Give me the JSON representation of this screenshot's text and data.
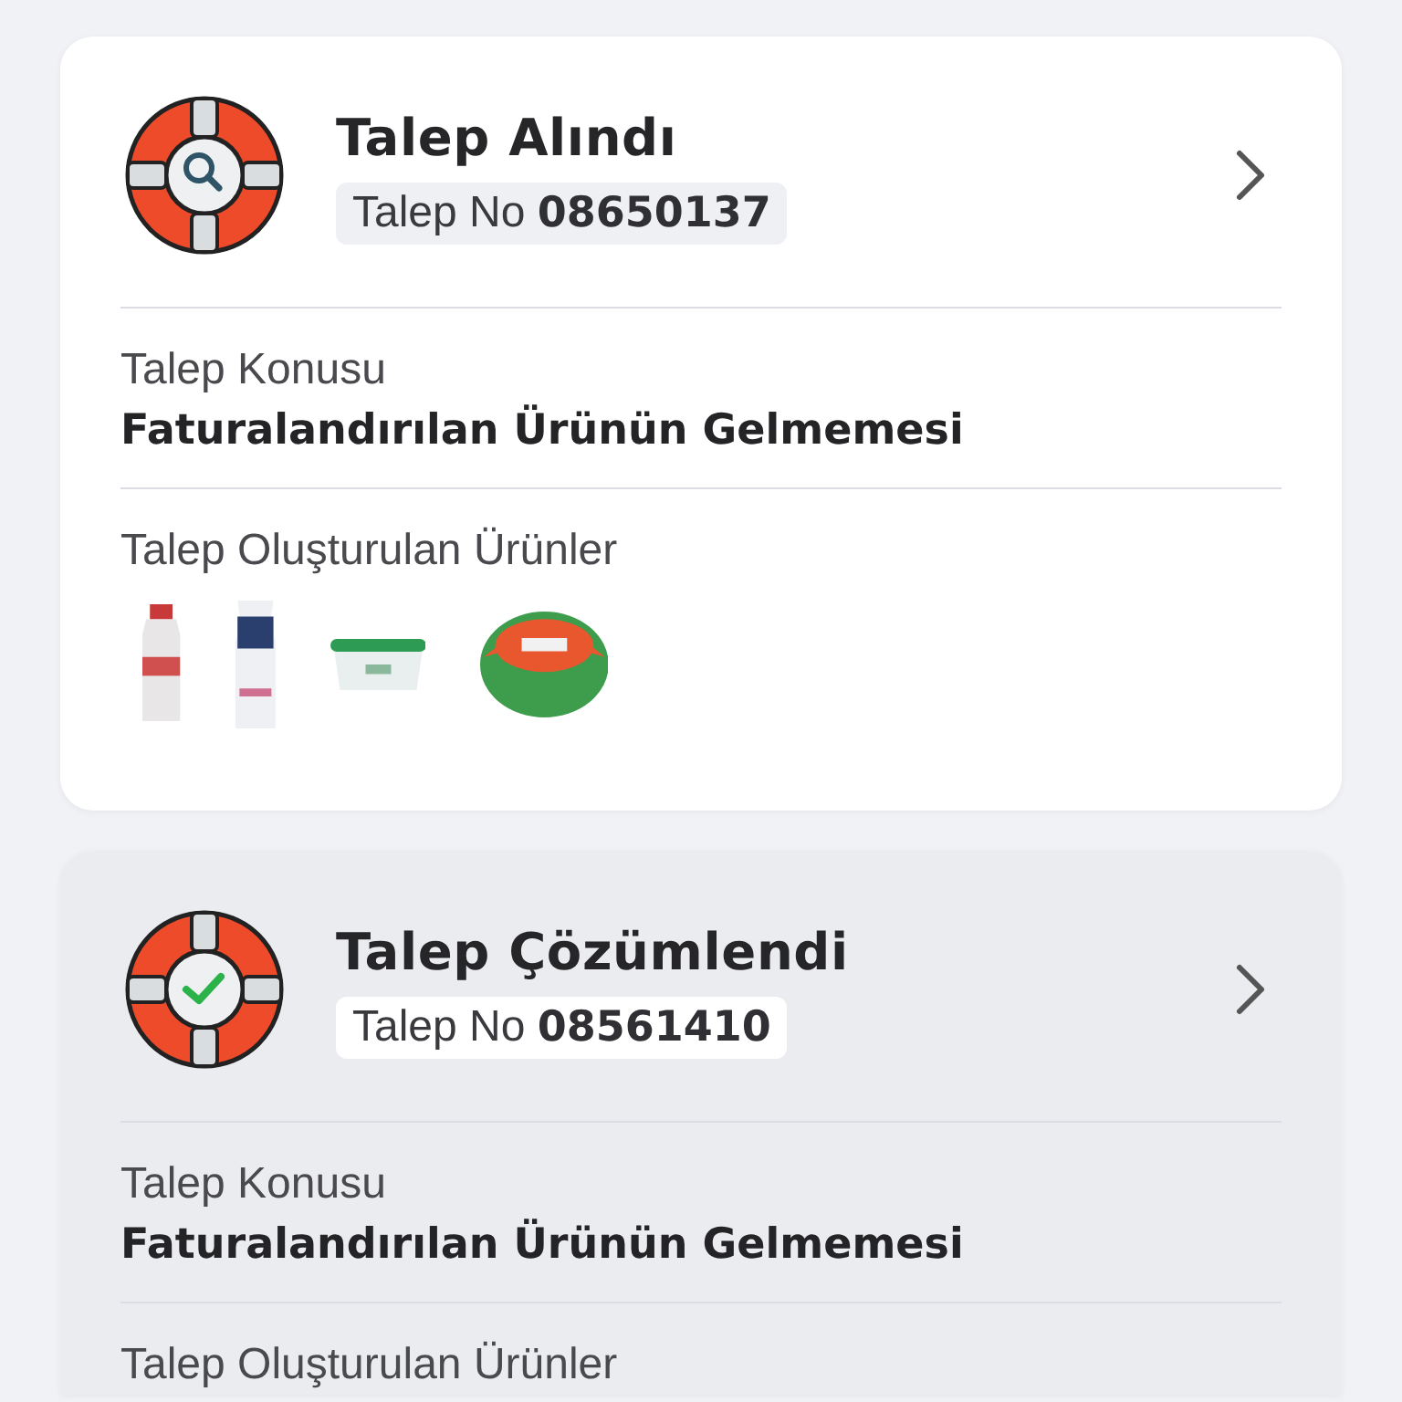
{
  "requests": [
    {
      "resolved": false,
      "title": "Talep Alındı",
      "number_label": "Talep No",
      "number": "08650137",
      "subject_label": "Talep Konusu",
      "subject": "Faturalandırılan Ürünün Gelmemesi",
      "products_label": "Talep Oluşturulan Ürünler"
    },
    {
      "resolved": true,
      "title": "Talep Çözümlendi",
      "number_label": "Talep No",
      "number": "08561410",
      "subject_label": "Talep Konusu",
      "subject": "Faturalandırılan Ürünün Gelmemesi",
      "products_label": "Talep Oluşturulan Ürünler"
    }
  ]
}
